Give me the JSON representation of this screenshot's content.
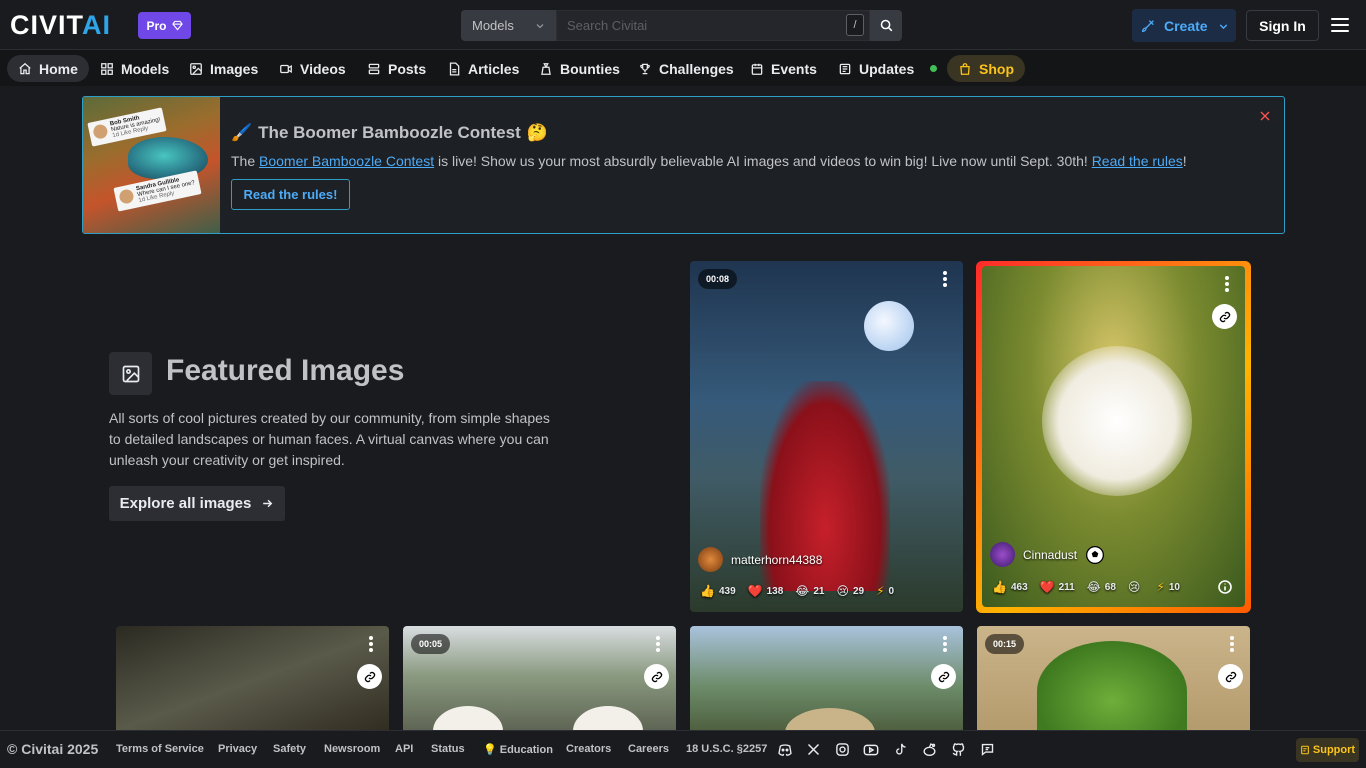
{
  "header": {
    "logo_main": "CIVIT",
    "logo_accent": "AI",
    "pro_label": "Pro",
    "search_type": "Models",
    "search_placeholder": "Search Civitai",
    "search_shortcut": "/",
    "create_label": "Create",
    "signin_label": "Sign In"
  },
  "nav": {
    "items": [
      {
        "label": "Home",
        "icon": "home-icon"
      },
      {
        "label": "Models",
        "icon": "models-icon"
      },
      {
        "label": "Images",
        "icon": "image-icon"
      },
      {
        "label": "Videos",
        "icon": "video-icon"
      },
      {
        "label": "Posts",
        "icon": "posts-icon"
      },
      {
        "label": "Articles",
        "icon": "article-icon"
      },
      {
        "label": "Bounties",
        "icon": "bounty-icon"
      },
      {
        "label": "Challenges",
        "icon": "trophy-icon"
      },
      {
        "label": "Events",
        "icon": "calendar-icon"
      },
      {
        "label": "Updates",
        "icon": "updates-icon"
      },
      {
        "label": "Shop",
        "icon": "shop-icon"
      }
    ]
  },
  "banner": {
    "title_emoji_left": "🖌️",
    "title": "The Boomer Bamboozle Contest",
    "title_emoji_right": "🤔",
    "text_pre": "The ",
    "link_contest": "Boomer Bamboozle Contest",
    "text_mid": " is live! Show us your most absurdly believable AI images and videos to win big! Live now until Sept. 30th! ",
    "link_rules": "Read the rules",
    "text_post": "!",
    "button_label": "Read the rules!",
    "card1_name": "Bob Smith",
    "card1_text": "Nature is amazing!",
    "card2_name": "Sandra Gullible",
    "card2_text": "Where can I see one?",
    "card_actions": "1d   Like   Reply"
  },
  "featured": {
    "title": "Featured Images",
    "description": "All sorts of cool pictures created by our community, from simple shapes to detailed landscapes or human faces. A virtual canvas where you can unleash your creativity or get inspired.",
    "button_label": "Explore all images"
  },
  "cards": [
    {
      "duration": "00:08",
      "username": "matterhorn44388",
      "likes": "439",
      "hearts": "138",
      "laughs": "21",
      "cries": "29",
      "buzz": "0"
    },
    {
      "username": "Cinnadust",
      "likes": "463",
      "hearts": "211",
      "laughs": "68",
      "cries": "",
      "buzz": "10"
    },
    {},
    {
      "duration": "00:05"
    },
    {},
    {
      "duration": "00:15"
    }
  ],
  "footer": {
    "copyright": "© Civitai 2025",
    "links": [
      "Terms of Service",
      "Privacy",
      "Safety",
      "Newsroom",
      "API",
      "Status",
      "💡 Education",
      "Creators",
      "Careers",
      "18 U.S.C. §2257"
    ],
    "support_label": "Support"
  },
  "colors": {
    "accent": "#2fa4e7",
    "pro": "#7048e8",
    "shop": "#fcc419"
  }
}
